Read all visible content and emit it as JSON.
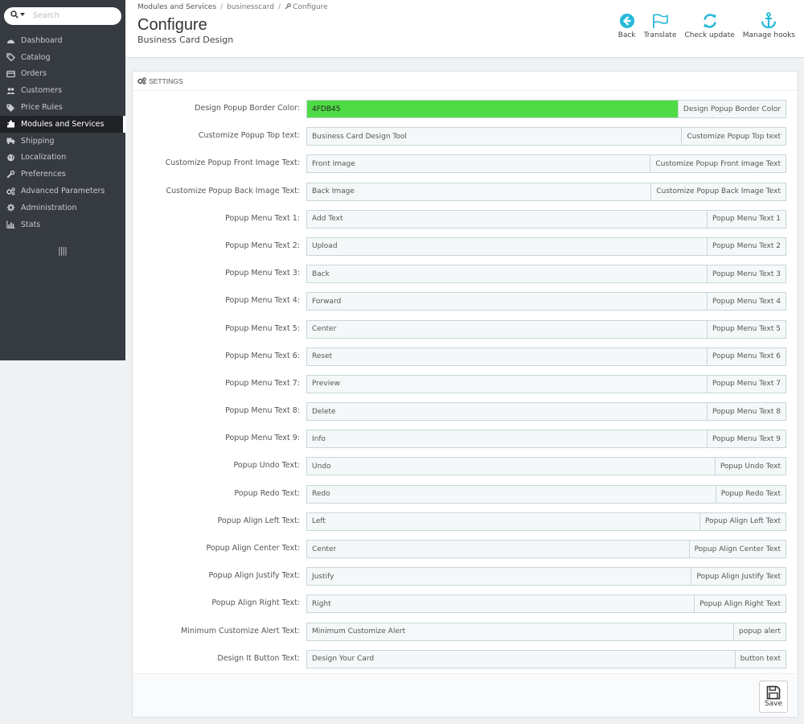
{
  "search": {
    "placeholder": "Search"
  },
  "sidebar": {
    "items": [
      {
        "label": "Dashboard",
        "icon": "dashboard-icon"
      },
      {
        "label": "Catalog",
        "icon": "catalog-icon"
      },
      {
        "label": "Orders",
        "icon": "orders-icon"
      },
      {
        "label": "Customers",
        "icon": "customers-icon"
      },
      {
        "label": "Price Rules",
        "icon": "tags-icon"
      },
      {
        "label": "Modules and Services",
        "icon": "puzzle-icon",
        "active": true
      },
      {
        "label": "Shipping",
        "icon": "truck-icon"
      },
      {
        "label": "Localization",
        "icon": "globe-icon"
      },
      {
        "label": "Preferences",
        "icon": "wrench-icon"
      },
      {
        "label": "Advanced Parameters",
        "icon": "cogs-icon"
      },
      {
        "label": "Administration",
        "icon": "gear-icon"
      },
      {
        "label": "Stats",
        "icon": "bar-chart-icon"
      }
    ],
    "collapse": "||||"
  },
  "breadcrumb": {
    "root": "Modules and Services",
    "module": "businesscard",
    "current": "Configure",
    "sep1": "/",
    "sep2": "/"
  },
  "header": {
    "title": "Configure",
    "subtitle": "Business Card Design"
  },
  "toolbar": {
    "back": "Back",
    "translate": "Translate",
    "check_update": "Check update",
    "manage_hooks": "Manage hooks"
  },
  "colors": {
    "accent": "#25b9d7",
    "border_color_value": "#4FDB45"
  },
  "panel": {
    "heading": "SETTINGS",
    "fields": [
      {
        "label": "Design Popup Border Color:",
        "value": "4FDB45",
        "addon": "Design Popup Border Color"
      },
      {
        "label": "Customize Popup Top text:",
        "value": "Business Card Design Tool",
        "addon": "Customize Popup Top text"
      },
      {
        "label": "Customize Popup Front Image Text:",
        "value": "Front Image",
        "addon": "Customize Popup Front Image Text"
      },
      {
        "label": "Customize Popup Back Image Text:",
        "value": "Back Image",
        "addon": "Customize Popup Back Image Text"
      },
      {
        "label": "Popup Menu Text 1:",
        "value": "Add Text",
        "addon": "Popup Menu Text 1"
      },
      {
        "label": "Popup Menu Text 2:",
        "value": "Upload",
        "addon": "Popup Menu Text 2"
      },
      {
        "label": "Popup Menu Text 3:",
        "value": "Back",
        "addon": "Popup Menu Text 3"
      },
      {
        "label": "Popup Menu Text 4:",
        "value": "Forward",
        "addon": "Popup Menu Text 4"
      },
      {
        "label": "Popup Menu Text 5:",
        "value": "Center",
        "addon": "Popup Menu Text 5"
      },
      {
        "label": "Popup Menu Text 6:",
        "value": "Reset",
        "addon": "Popup Menu Text 6"
      },
      {
        "label": "Popup Menu Text 7:",
        "value": "Preview",
        "addon": "Popup Menu Text 7"
      },
      {
        "label": "Popup Menu Text 8:",
        "value": "Delete",
        "addon": "Popup Menu Text 8"
      },
      {
        "label": "Popup Menu Text 9:",
        "value": "Info",
        "addon": "Popup Menu Text 9"
      },
      {
        "label": "Popup Undo Text:",
        "value": "Undo",
        "addon": "Popup Undo Text"
      },
      {
        "label": "Popup Redo Text:",
        "value": "Redo",
        "addon": "Popup Redo Text"
      },
      {
        "label": "Popup Align Left Text:",
        "value": "Left",
        "addon": "Popup Align Left Text"
      },
      {
        "label": "Popup Align Center Text:",
        "value": "Center",
        "addon": "Popup Align Center Text"
      },
      {
        "label": "Popup Align Justify Text:",
        "value": "Justify",
        "addon": "Popup Align Justify Text"
      },
      {
        "label": "Popup Align Right Text:",
        "value": "Right",
        "addon": "Popup Align Right Text"
      },
      {
        "label": "Minimum Customize Alert Text:",
        "value": "Minimum Customize Alert",
        "addon": "popup alert"
      },
      {
        "label": "Design It Button Text:",
        "value": "Design Your Card",
        "addon": "button text"
      }
    ],
    "save": "Save"
  }
}
